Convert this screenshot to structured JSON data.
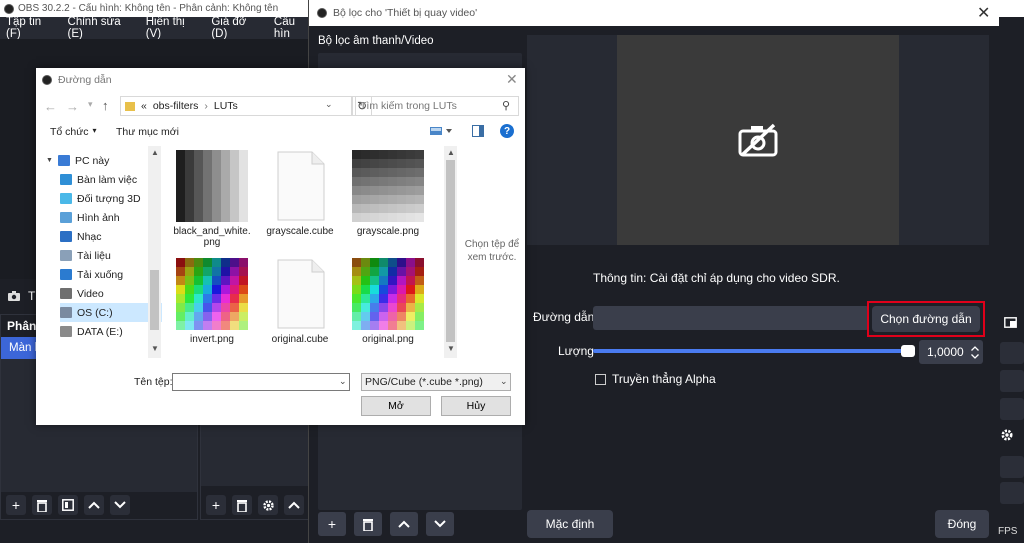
{
  "obs": {
    "title": "OBS 30.2.2 - Cấu hình: Không tên - Phân cảnh: Không tên",
    "menu": [
      "Tập tin (F)",
      "Chỉnh sửa (E)",
      "Hiển thị (V)",
      "Giá đỡ (D)",
      "Cấu hìn"
    ],
    "scene_tab_label": "T",
    "scenes_title": "Phân",
    "scene_item": "Màn h",
    "fps_label": "FPS"
  },
  "filters": {
    "title": "Bộ lọc cho 'Thiết bị quay video'",
    "left_header": "Bộ lọc âm thanh/Video",
    "info_text": "Thông tin: Cài đặt chỉ áp dụng cho video SDR.",
    "path_label": "Đường dẫn",
    "path_value": "",
    "browse_button": "Chọn đường dẫn",
    "amount_label": "Lượng",
    "amount_value": "1,0000",
    "amount_fraction": 1.0,
    "passthrough_alpha_label": "Truyền thẳng Alpha",
    "passthrough_alpha_checked": false,
    "defaults_button": "Mặc định",
    "close_button": "Đóng"
  },
  "file_dialog": {
    "title": "Đường dẫn",
    "breadcrumb": [
      "«",
      "obs-filters",
      "LUTs"
    ],
    "search_placeholder": "Tìm kiếm trong LUTs",
    "organize_label": "Tổ chức",
    "new_folder_label": "Thư mục mới",
    "nav_items": [
      {
        "label": "PC này",
        "icon": "pc-icon",
        "color": "#3a7bd5"
      },
      {
        "label": "Bàn làm việc",
        "icon": "desktop-icon",
        "color": "#2f8fd6"
      },
      {
        "label": "Đối tượng 3D",
        "icon": "3d-objects-icon",
        "color": "#4ab8e8"
      },
      {
        "label": "Hình ảnh",
        "icon": "pictures-icon",
        "color": "#5aa0d8"
      },
      {
        "label": "Nhạc",
        "icon": "music-icon",
        "color": "#2b6fc4"
      },
      {
        "label": "Tài liệu",
        "icon": "documents-icon",
        "color": "#8aa0b8"
      },
      {
        "label": "Tải xuống",
        "icon": "downloads-icon",
        "color": "#2b7bd0"
      },
      {
        "label": "Video",
        "icon": "video-icon",
        "color": "#6f6f6f"
      },
      {
        "label": "OS (C:)",
        "icon": "drive-icon",
        "color": "#7a8aa0"
      },
      {
        "label": "DATA (E:)",
        "icon": "drive-icon",
        "color": "#8a8a8a"
      }
    ],
    "files": [
      {
        "name": "black_and_white.\npng",
        "kind": "bw"
      },
      {
        "name": "grayscale.cube",
        "kind": "doc"
      },
      {
        "name": "grayscale.png",
        "kind": "gray"
      },
      {
        "name": "invert.png",
        "kind": "color"
      },
      {
        "name": "original.cube",
        "kind": "doc"
      },
      {
        "name": "original.png",
        "kind": "color2"
      }
    ],
    "preview_hint": "Chọn tệp để xem trước.",
    "filename_label": "Tên tệp:",
    "filename_value": "",
    "filter_value": "PNG/Cube (*.cube *.png)",
    "open_button": "Mở",
    "cancel_button": "Hủy"
  },
  "colors": {
    "accent_blue": "#3c66d8",
    "highlight_red": "#e0001a",
    "slider_blue": "#4a7bf0"
  }
}
